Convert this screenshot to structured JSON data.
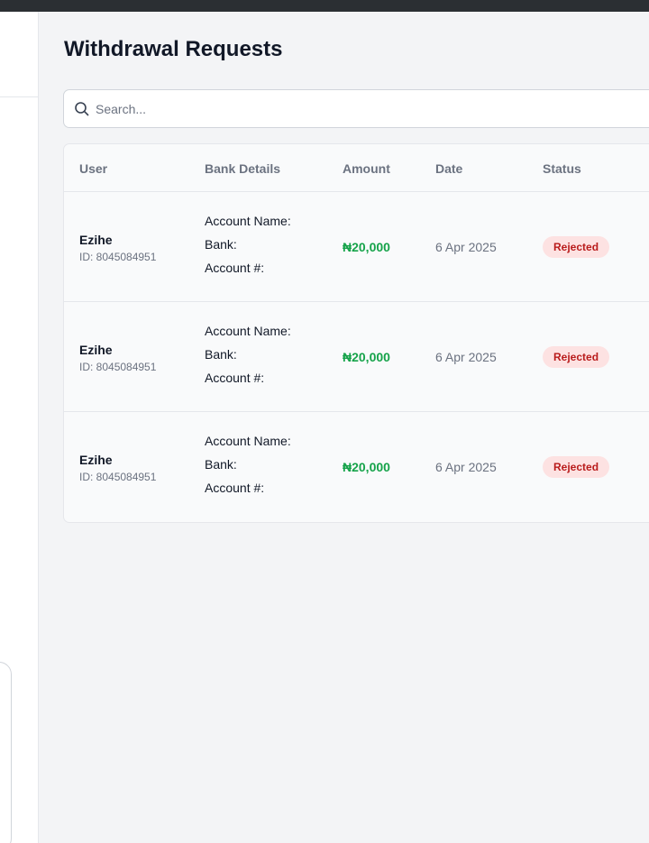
{
  "page": {
    "title": "Withdrawal Requests"
  },
  "search": {
    "placeholder": "Search...",
    "value": ""
  },
  "table": {
    "columns": [
      "User",
      "Bank Details",
      "Amount",
      "Date",
      "Status"
    ],
    "bank_labels": {
      "account_name": "Account Name:",
      "bank": "Bank:",
      "account_number": "Account #:"
    },
    "rows": [
      {
        "user_name": "Ezihe",
        "user_id": "ID: 8045084951",
        "amount": "₦20,000",
        "date": "6 Apr 2025",
        "status": "Rejected"
      },
      {
        "user_name": "Ezihe",
        "user_id": "ID: 8045084951",
        "amount": "₦20,000",
        "date": "6 Apr 2025",
        "status": "Rejected"
      },
      {
        "user_name": "Ezihe",
        "user_id": "ID: 8045084951",
        "amount": "₦20,000",
        "date": "6 Apr 2025",
        "status": "Rejected"
      }
    ]
  },
  "colors": {
    "amount": "#16a34a",
    "status_rejected_bg": "#fde2e2",
    "status_rejected_text": "#b91c1c"
  },
  "icons": {
    "search": "search-icon"
  }
}
